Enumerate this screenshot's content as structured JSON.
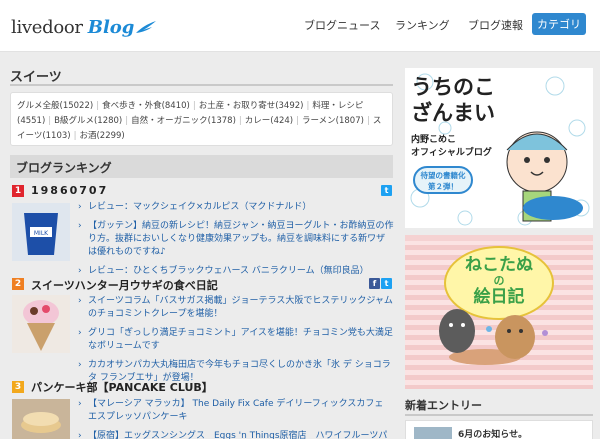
{
  "header": {
    "logo_text": "livedoor",
    "logo_blog": "Blog",
    "nav": [
      "ブログニュース",
      "ランキング",
      "ブログ速報"
    ],
    "category_button": "カテゴリ"
  },
  "sweets": {
    "title": "スイーツ",
    "tags": [
      "グルメ全般(15022)",
      "食べ歩き・外食(8410)",
      "お土産・お取り寄せ(3492)",
      "料理・レシピ(4551)",
      "B級グルメ(1280)",
      "自然・オーガニック(1378)",
      "カレー(424)",
      "ラーメン(1807)",
      "スイーツ(1103)",
      "お酒(2299)"
    ]
  },
  "ranking": {
    "title": "ブログランキング",
    "blogs": [
      {
        "rank": "1",
        "name": "19860707",
        "entries": [
          "レビュー：マックシェイク×カルピス（マクドナルド）",
          "【ガッテン】納豆の新レシピ！納豆ジャン・納豆ヨーグルト・お酢納豆の作り方。抜群においしくなり健康効果アップも。納豆を調味料にする新ワザは優れものですね♪",
          "レビュー：ひとくちブラックウェハース バニラクリーム（無印良品）"
        ]
      },
      {
        "rank": "2",
        "name": "スイーツハンター月ウサギの食べ日記",
        "entries": [
          "スイーツコラム「バスサガス掲載」ジョーテラス大阪でヒステリックジャムのチョコミントクレープを堪能！",
          "グリコ「ぎっしり満足チョコミント」アイスを堪能！チョコミン党も大満足なボリュームです",
          "カカオサンパカ大丸梅田店で今年もチョコ尽くしのかき氷「氷 デ ショコラタ フランブエサ」が登場！"
        ]
      },
      {
        "rank": "3",
        "name": "パンケーキ部【PANCAKE CLUB】",
        "entries": [
          "【マレーシア マラッカ】 The Daily Fix Cafe デイリーフィックスカフェ エスプレッソパンケーキ",
          "【原宿】エッグスンシングス　Eggs 'n Things原宿店　ハワイフルーツパンケーキ"
        ]
      }
    ]
  },
  "sidebar": {
    "banner1": {
      "line1": "うちのこ",
      "line2": "ざんまい",
      "sub1": "内野こめこ",
      "sub2": "オフィシャルブログ",
      "badge1": "待望の書籍化",
      "badge2": "第２弾！"
    },
    "banner2": {
      "line1": "ねこたぬ",
      "line2": "の",
      "line3": "絵日記"
    },
    "new_entries_title": "新着エントリー",
    "new_entry_1": "6月のお知らせ。"
  },
  "colors": {
    "accent": "#2f88cf",
    "rank1": "#e0252e",
    "rank2": "#ef7f22",
    "rank3": "#f2a81c",
    "link": "#1f5fa6"
  }
}
